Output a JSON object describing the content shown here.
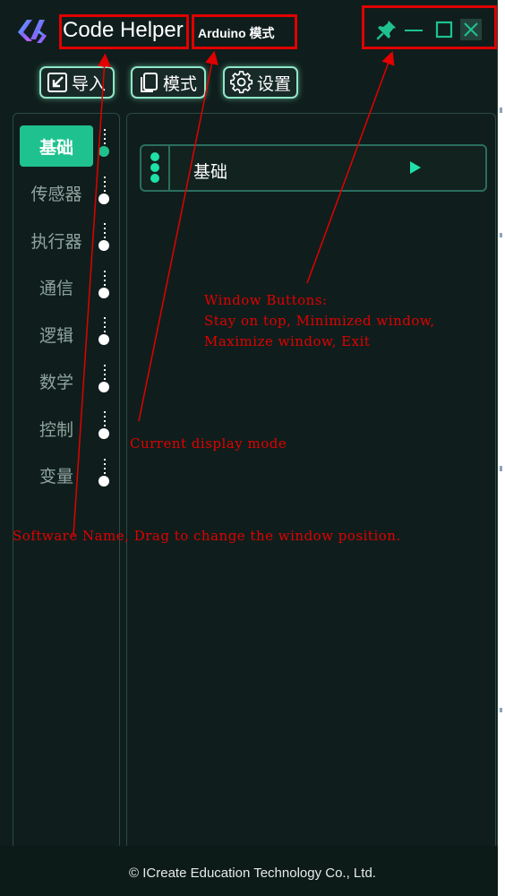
{
  "titlebar": {
    "app_name": "Code Helper",
    "mode": "Arduino 模式",
    "buttons": [
      {
        "name": "pin-button",
        "icon": "pin-icon"
      },
      {
        "name": "minimize-button",
        "icon": "minimize-icon"
      },
      {
        "name": "maximize-button",
        "icon": "maximize-icon"
      },
      {
        "name": "close-button",
        "icon": "close-icon"
      }
    ]
  },
  "toolbar": {
    "import_label": "导入",
    "mode_label": "模式",
    "settings_label": "设置"
  },
  "sidebar": {
    "items": [
      {
        "label": "基础",
        "active": true
      },
      {
        "label": "传感器",
        "active": false
      },
      {
        "label": "执行器",
        "active": false
      },
      {
        "label": "通信",
        "active": false
      },
      {
        "label": "逻辑",
        "active": false
      },
      {
        "label": "数学",
        "active": false
      },
      {
        "label": "控制",
        "active": false
      },
      {
        "label": "变量",
        "active": false
      }
    ]
  },
  "main": {
    "block_title": "基础"
  },
  "footer": {
    "copyright": "© ICreate Education Technology Co., Ltd."
  },
  "annotations": {
    "window_buttons": [
      "Window Buttons:",
      "Stay on top, Minimized window,",
      "Maximize window, Exit"
    ],
    "display_mode": "Current display mode",
    "software_name": "Software Name, Drag to change the window position."
  },
  "colors": {
    "background": "#0f1e1c",
    "accent": "#1fc28e",
    "annotation": "#e10000"
  }
}
